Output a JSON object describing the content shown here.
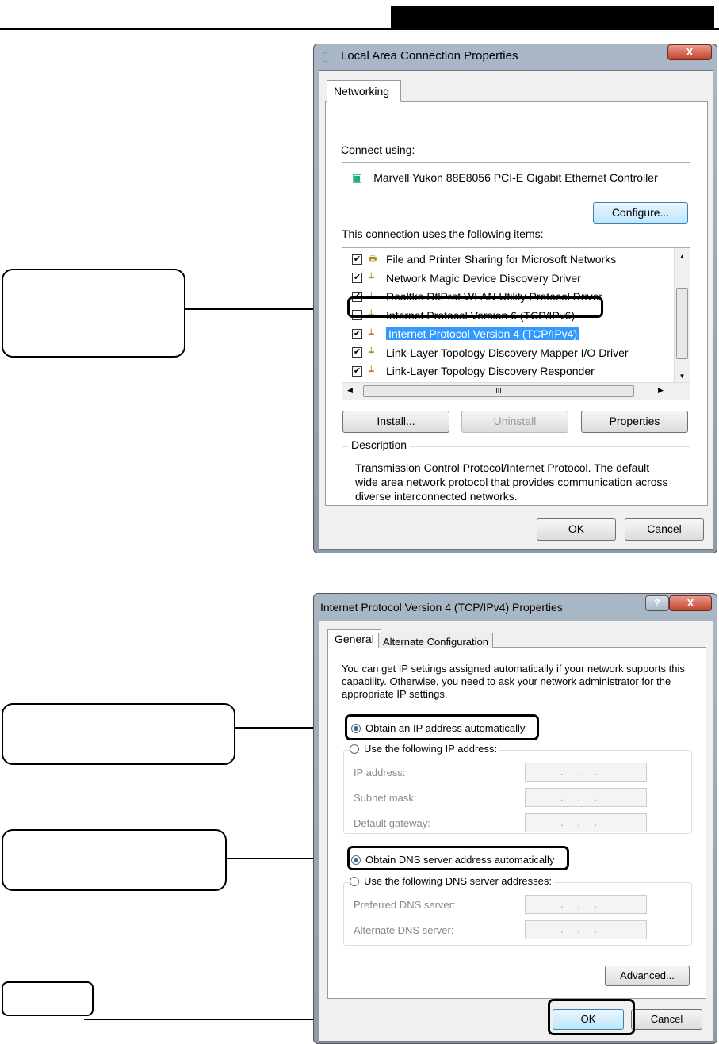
{
  "dialog1": {
    "title": "Local Area Connection Properties",
    "close": "X",
    "tab": "Networking",
    "connect_using_label": "Connect using:",
    "adapter": "Marvell Yukon 88E8056 PCI-E Gigabit Ethernet Controller",
    "configure": "Configure...",
    "items_label": "This connection uses the following items:",
    "items": [
      {
        "label": "File and Printer Sharing for Microsoft Networks",
        "checked": true
      },
      {
        "label": "Network Magic Device Discovery Driver",
        "checked": true
      },
      {
        "label": "Realtke RtlProt WLAN Utility Protocol Driver",
        "checked": true
      },
      {
        "label": "Internet Protocol Version 6 (TCP/IPv6)",
        "checked": false
      },
      {
        "label": "Internet Protocol Version 4 (TCP/IPv4)",
        "checked": true
      },
      {
        "label": "Link-Layer Topology Discovery Mapper I/O Driver",
        "checked": true
      },
      {
        "label": "Link-Layer Topology Discovery Responder",
        "checked": true
      }
    ],
    "check": "✔",
    "hscroll_grip": "III",
    "install": "Install...",
    "uninstall": "Uninstall",
    "properties": "Properties",
    "description_label": "Description",
    "description": "Transmission Control Protocol/Internet Protocol. The default wide area network protocol that provides communication across diverse interconnected networks.",
    "ok": "OK",
    "cancel": "Cancel"
  },
  "dialog2": {
    "title": "Internet Protocol Version 4 (TCP/IPv4) Properties",
    "help": "?",
    "close": "X",
    "tabs": [
      "General",
      "Alternate Configuration"
    ],
    "intro": "You can get IP settings assigned automatically if your network supports this capability. Otherwise, you need to ask your network administrator for the appropriate IP settings.",
    "obtain_ip": "Obtain an IP address automatically",
    "use_ip": "Use the following IP address:",
    "ip_address": "IP address:",
    "subnet": "Subnet mask:",
    "gateway": "Default gateway:",
    "ip_placeholder": "...",
    "obtain_dns": "Obtain DNS server address automatically",
    "use_dns": "Use the following DNS server addresses:",
    "pref_dns": "Preferred DNS server:",
    "alt_dns": "Alternate DNS server:",
    "advanced": "Advanced...",
    "ok": "OK",
    "cancel": "Cancel"
  }
}
